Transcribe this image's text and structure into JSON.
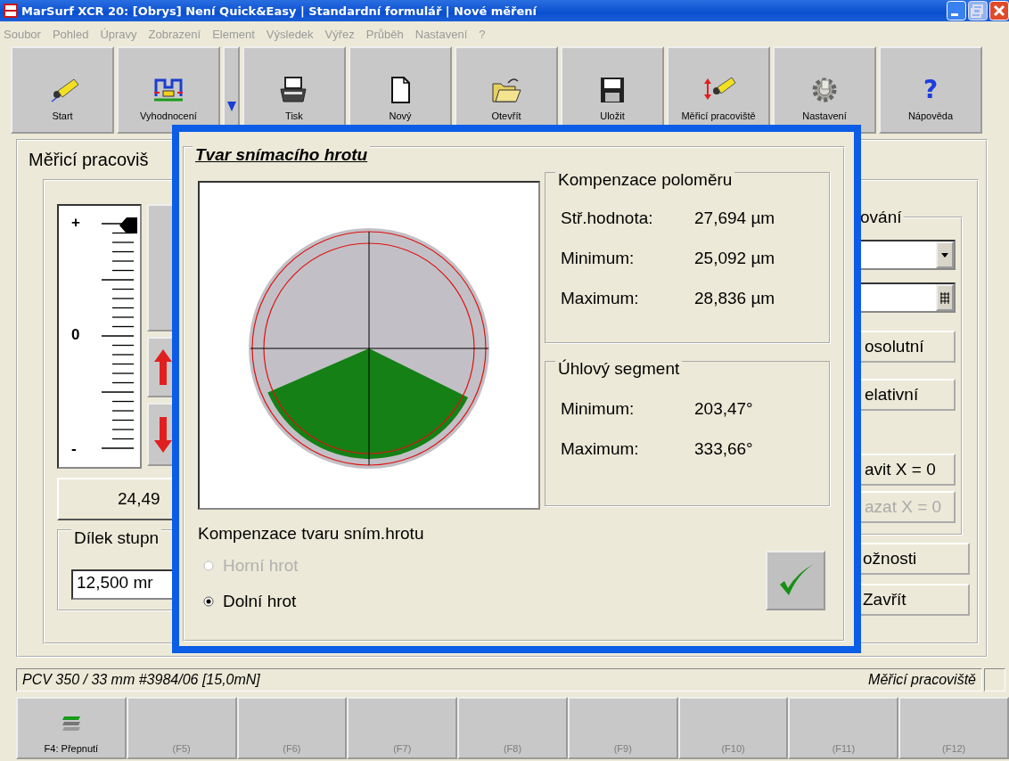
{
  "window": {
    "title": "MarSurf XCR 20: [Obrys] Není Quick&Easy | Standardní formulář | Nové měření"
  },
  "menu": [
    {
      "label": "Soubor",
      "disabled": true
    },
    {
      "label": "Pohled",
      "disabled": true
    },
    {
      "label": "Úpravy",
      "disabled": true
    },
    {
      "label": "Zobrazení",
      "disabled": true
    },
    {
      "label": "Element",
      "disabled": true
    },
    {
      "label": "Výsledek",
      "disabled": true
    },
    {
      "label": "Výřez",
      "disabled": true
    },
    {
      "label": "Průběh",
      "disabled": true
    },
    {
      "label": "Nastavení",
      "disabled": true
    },
    {
      "label": "?",
      "disabled": true
    }
  ],
  "toolbar": [
    {
      "label": "Start",
      "kind": "probe"
    },
    {
      "label": "Vyhodnocení",
      "kind": "evaluation"
    },
    {
      "kind": "dropdown"
    },
    {
      "label": "Tisk",
      "kind": "printer"
    },
    {
      "label": "Nový",
      "kind": "document"
    },
    {
      "label": "Otevřít",
      "kind": "folder"
    },
    {
      "label": "Uložit",
      "kind": "floppy"
    },
    {
      "label": "Měřicí pracoviště",
      "kind": "station"
    },
    {
      "label": "Nastavení",
      "kind": "gear"
    },
    {
      "label": "Nápověda",
      "kind": "help",
      "glyph": "?"
    }
  ],
  "main": {
    "panel_title": "Měřicí pracoviš",
    "gauge": {
      "plus": "+",
      "zero": "0",
      "minus": "-"
    },
    "reading": "24,49",
    "step_group": {
      "title": "Dílek stupn",
      "value": "12,500 mr"
    },
    "right_group": {
      "title": "ování",
      "buttons": [
        {
          "label": "osolutní",
          "disabled": false
        },
        {
          "label": "elativní",
          "disabled": false
        },
        {
          "label": "avit X = 0",
          "disabled": false
        },
        {
          "label": "azat X = 0",
          "disabled": true
        }
      ]
    },
    "buttons": [
      {
        "label": "ožnosti"
      },
      {
        "label": "Zavřít"
      }
    ]
  },
  "dialog": {
    "title": "Tvar snímacího hrotu",
    "radius": {
      "title": "Kompenzace poloměru",
      "rows": [
        {
          "label": "Stř.hodnota:",
          "value": "27,694 µm"
        },
        {
          "label": "Minimum:",
          "value": "25,092 µm"
        },
        {
          "label": "Maximum:",
          "value": "28,836 µm"
        }
      ]
    },
    "segment": {
      "title": "Úhlový segment",
      "rows": [
        {
          "label": "Minimum:",
          "value": "203,47°"
        },
        {
          "label": "Maximum:",
          "value": "333,66°"
        }
      ]
    },
    "shape": {
      "title": "Kompenzace tvaru sním.hrotu",
      "options": [
        {
          "label": "Horní hrot",
          "selected": false,
          "disabled": true
        },
        {
          "label": "Dolní hrot",
          "selected": true,
          "disabled": false
        }
      ]
    }
  },
  "status_bar": {
    "left": "PCV 350 / 33 mm #3984/06 [15,0mN]",
    "right": "Měřicí pracoviště"
  },
  "function_keys": [
    {
      "label": "F4: Přepnutí",
      "disabled": false
    },
    {
      "label": "(F5)",
      "disabled": true
    },
    {
      "label": "(F6)",
      "disabled": true
    },
    {
      "label": "(F7)",
      "disabled": true
    },
    {
      "label": "(F8)",
      "disabled": true
    },
    {
      "label": "(F9)",
      "disabled": true
    },
    {
      "label": "(F10)",
      "disabled": true
    },
    {
      "label": "(F11)",
      "disabled": true
    },
    {
      "label": "(F12)",
      "disabled": true
    }
  ]
}
